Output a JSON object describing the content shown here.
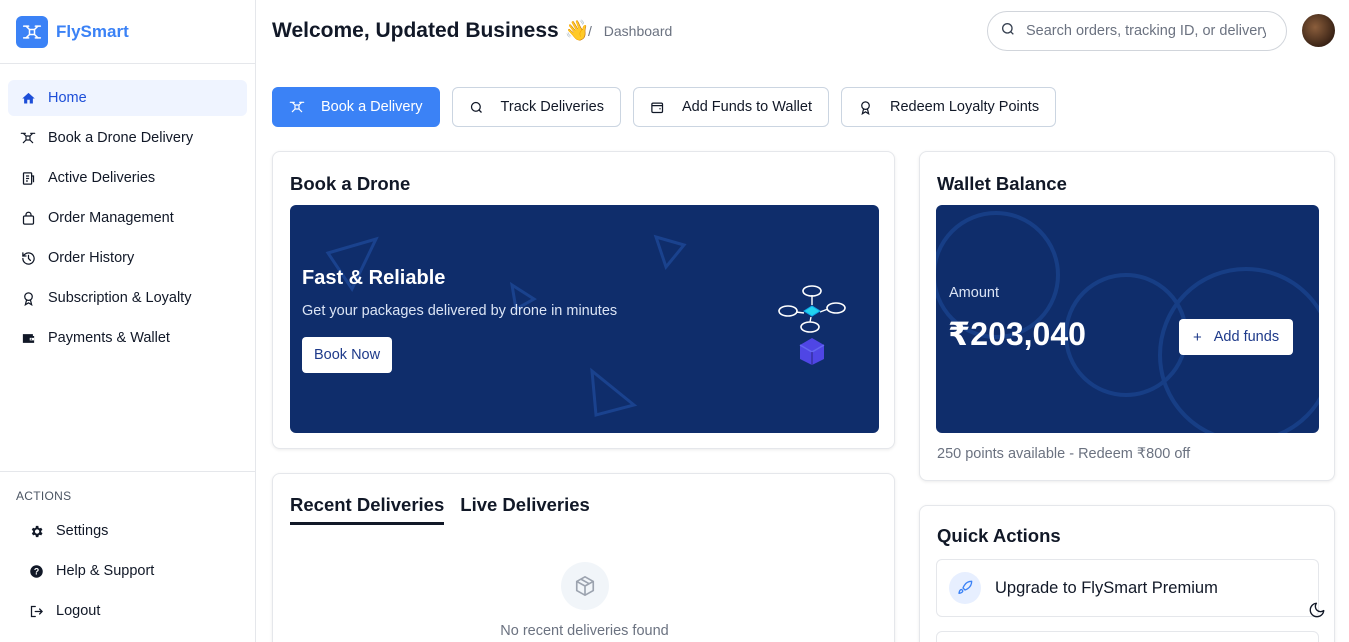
{
  "brand": {
    "name": "FlySmart"
  },
  "sidebar": {
    "items": [
      {
        "label": "Home",
        "icon": "home-icon",
        "active": true
      },
      {
        "label": "Book a Drone Delivery",
        "icon": "drone-icon"
      },
      {
        "label": "Active Deliveries",
        "icon": "clipboard-icon"
      },
      {
        "label": "Order Management",
        "icon": "bag-icon"
      },
      {
        "label": "Order History",
        "icon": "history-icon"
      },
      {
        "label": "Subscription & Loyalty",
        "icon": "award-icon"
      },
      {
        "label": "Payments & Wallet",
        "icon": "wallet-icon"
      }
    ],
    "actions_title": "ACTIONS",
    "actions": [
      {
        "label": "Settings",
        "icon": "gear-icon"
      },
      {
        "label": "Help & Support",
        "icon": "help-icon"
      },
      {
        "label": "Logout",
        "icon": "logout-icon"
      }
    ]
  },
  "header": {
    "welcome": "Welcome, Updated Business",
    "wave": "👋",
    "breadcrumb_sep": "/",
    "breadcrumb": "Dashboard",
    "search_placeholder": "Search orders, tracking ID, or delivery"
  },
  "quick_buttons": [
    {
      "label": "Book a Delivery",
      "icon": "drone-icon",
      "primary": true
    },
    {
      "label": "Track Deliveries",
      "icon": "search-icon"
    },
    {
      "label": "Add Funds to Wallet",
      "icon": "wallet-icon"
    },
    {
      "label": "Redeem Loyalty Points",
      "icon": "award-icon"
    }
  ],
  "book_card": {
    "title": "Book a Drone",
    "hero_title": "Fast & Reliable",
    "hero_sub": "Get your packages delivered by drone in minutes",
    "hero_button": "Book Now"
  },
  "recent_card": {
    "tabs": [
      "Recent Deliveries",
      "Live Deliveries"
    ],
    "empty_text": "No recent deliveries found"
  },
  "wallet_card": {
    "title": "Wallet Balance",
    "amount_label": "Amount",
    "amount": "₹203,040",
    "add_button_plus": "+",
    "add_button": "Add funds",
    "points_text": "250 points available - Redeem ₹800 off"
  },
  "quick_actions": {
    "title": "Quick Actions",
    "items": [
      {
        "label": "Upgrade to FlySmart Premium",
        "icon": "rocket-icon"
      }
    ]
  },
  "colors": {
    "accent": "#3b82f6",
    "hero_bg": "#0f2d6b",
    "active_bg": "#eff4ff"
  }
}
